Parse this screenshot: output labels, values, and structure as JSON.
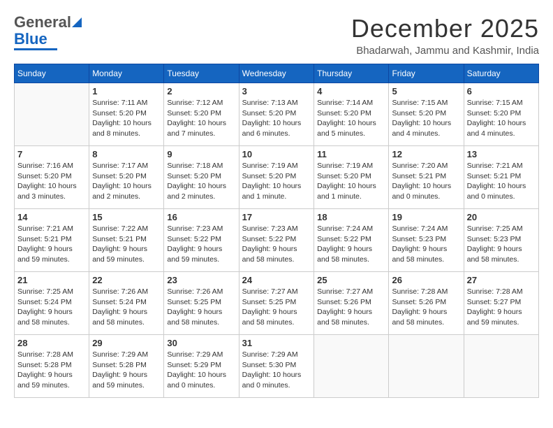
{
  "header": {
    "logo_general": "General",
    "logo_blue": "Blue",
    "month_title": "December 2025",
    "subtitle": "Bhadarwah, Jammu and Kashmir, India"
  },
  "calendar": {
    "days_of_week": [
      "Sunday",
      "Monday",
      "Tuesday",
      "Wednesday",
      "Thursday",
      "Friday",
      "Saturday"
    ],
    "weeks": [
      [
        {
          "day": "",
          "info": ""
        },
        {
          "day": "1",
          "info": "Sunrise: 7:11 AM\nSunset: 5:20 PM\nDaylight: 10 hours\nand 8 minutes."
        },
        {
          "day": "2",
          "info": "Sunrise: 7:12 AM\nSunset: 5:20 PM\nDaylight: 10 hours\nand 7 minutes."
        },
        {
          "day": "3",
          "info": "Sunrise: 7:13 AM\nSunset: 5:20 PM\nDaylight: 10 hours\nand 6 minutes."
        },
        {
          "day": "4",
          "info": "Sunrise: 7:14 AM\nSunset: 5:20 PM\nDaylight: 10 hours\nand 5 minutes."
        },
        {
          "day": "5",
          "info": "Sunrise: 7:15 AM\nSunset: 5:20 PM\nDaylight: 10 hours\nand 4 minutes."
        },
        {
          "day": "6",
          "info": "Sunrise: 7:15 AM\nSunset: 5:20 PM\nDaylight: 10 hours\nand 4 minutes."
        }
      ],
      [
        {
          "day": "7",
          "info": "Sunrise: 7:16 AM\nSunset: 5:20 PM\nDaylight: 10 hours\nand 3 minutes."
        },
        {
          "day": "8",
          "info": "Sunrise: 7:17 AM\nSunset: 5:20 PM\nDaylight: 10 hours\nand 2 minutes."
        },
        {
          "day": "9",
          "info": "Sunrise: 7:18 AM\nSunset: 5:20 PM\nDaylight: 10 hours\nand 2 minutes."
        },
        {
          "day": "10",
          "info": "Sunrise: 7:19 AM\nSunset: 5:20 PM\nDaylight: 10 hours\nand 1 minute."
        },
        {
          "day": "11",
          "info": "Sunrise: 7:19 AM\nSunset: 5:20 PM\nDaylight: 10 hours\nand 1 minute."
        },
        {
          "day": "12",
          "info": "Sunrise: 7:20 AM\nSunset: 5:21 PM\nDaylight: 10 hours\nand 0 minutes."
        },
        {
          "day": "13",
          "info": "Sunrise: 7:21 AM\nSunset: 5:21 PM\nDaylight: 10 hours\nand 0 minutes."
        }
      ],
      [
        {
          "day": "14",
          "info": "Sunrise: 7:21 AM\nSunset: 5:21 PM\nDaylight: 9 hours\nand 59 minutes."
        },
        {
          "day": "15",
          "info": "Sunrise: 7:22 AM\nSunset: 5:21 PM\nDaylight: 9 hours\nand 59 minutes."
        },
        {
          "day": "16",
          "info": "Sunrise: 7:23 AM\nSunset: 5:22 PM\nDaylight: 9 hours\nand 59 minutes."
        },
        {
          "day": "17",
          "info": "Sunrise: 7:23 AM\nSunset: 5:22 PM\nDaylight: 9 hours\nand 58 minutes."
        },
        {
          "day": "18",
          "info": "Sunrise: 7:24 AM\nSunset: 5:22 PM\nDaylight: 9 hours\nand 58 minutes."
        },
        {
          "day": "19",
          "info": "Sunrise: 7:24 AM\nSunset: 5:23 PM\nDaylight: 9 hours\nand 58 minutes."
        },
        {
          "day": "20",
          "info": "Sunrise: 7:25 AM\nSunset: 5:23 PM\nDaylight: 9 hours\nand 58 minutes."
        }
      ],
      [
        {
          "day": "21",
          "info": "Sunrise: 7:25 AM\nSunset: 5:24 PM\nDaylight: 9 hours\nand 58 minutes."
        },
        {
          "day": "22",
          "info": "Sunrise: 7:26 AM\nSunset: 5:24 PM\nDaylight: 9 hours\nand 58 minutes."
        },
        {
          "day": "23",
          "info": "Sunrise: 7:26 AM\nSunset: 5:25 PM\nDaylight: 9 hours\nand 58 minutes."
        },
        {
          "day": "24",
          "info": "Sunrise: 7:27 AM\nSunset: 5:25 PM\nDaylight: 9 hours\nand 58 minutes."
        },
        {
          "day": "25",
          "info": "Sunrise: 7:27 AM\nSunset: 5:26 PM\nDaylight: 9 hours\nand 58 minutes."
        },
        {
          "day": "26",
          "info": "Sunrise: 7:28 AM\nSunset: 5:26 PM\nDaylight: 9 hours\nand 58 minutes."
        },
        {
          "day": "27",
          "info": "Sunrise: 7:28 AM\nSunset: 5:27 PM\nDaylight: 9 hours\nand 59 minutes."
        }
      ],
      [
        {
          "day": "28",
          "info": "Sunrise: 7:28 AM\nSunset: 5:28 PM\nDaylight: 9 hours\nand 59 minutes."
        },
        {
          "day": "29",
          "info": "Sunrise: 7:29 AM\nSunset: 5:28 PM\nDaylight: 9 hours\nand 59 minutes."
        },
        {
          "day": "30",
          "info": "Sunrise: 7:29 AM\nSunset: 5:29 PM\nDaylight: 10 hours\nand 0 minutes."
        },
        {
          "day": "31",
          "info": "Sunrise: 7:29 AM\nSunset: 5:30 PM\nDaylight: 10 hours\nand 0 minutes."
        },
        {
          "day": "",
          "info": ""
        },
        {
          "day": "",
          "info": ""
        },
        {
          "day": "",
          "info": ""
        }
      ]
    ]
  }
}
